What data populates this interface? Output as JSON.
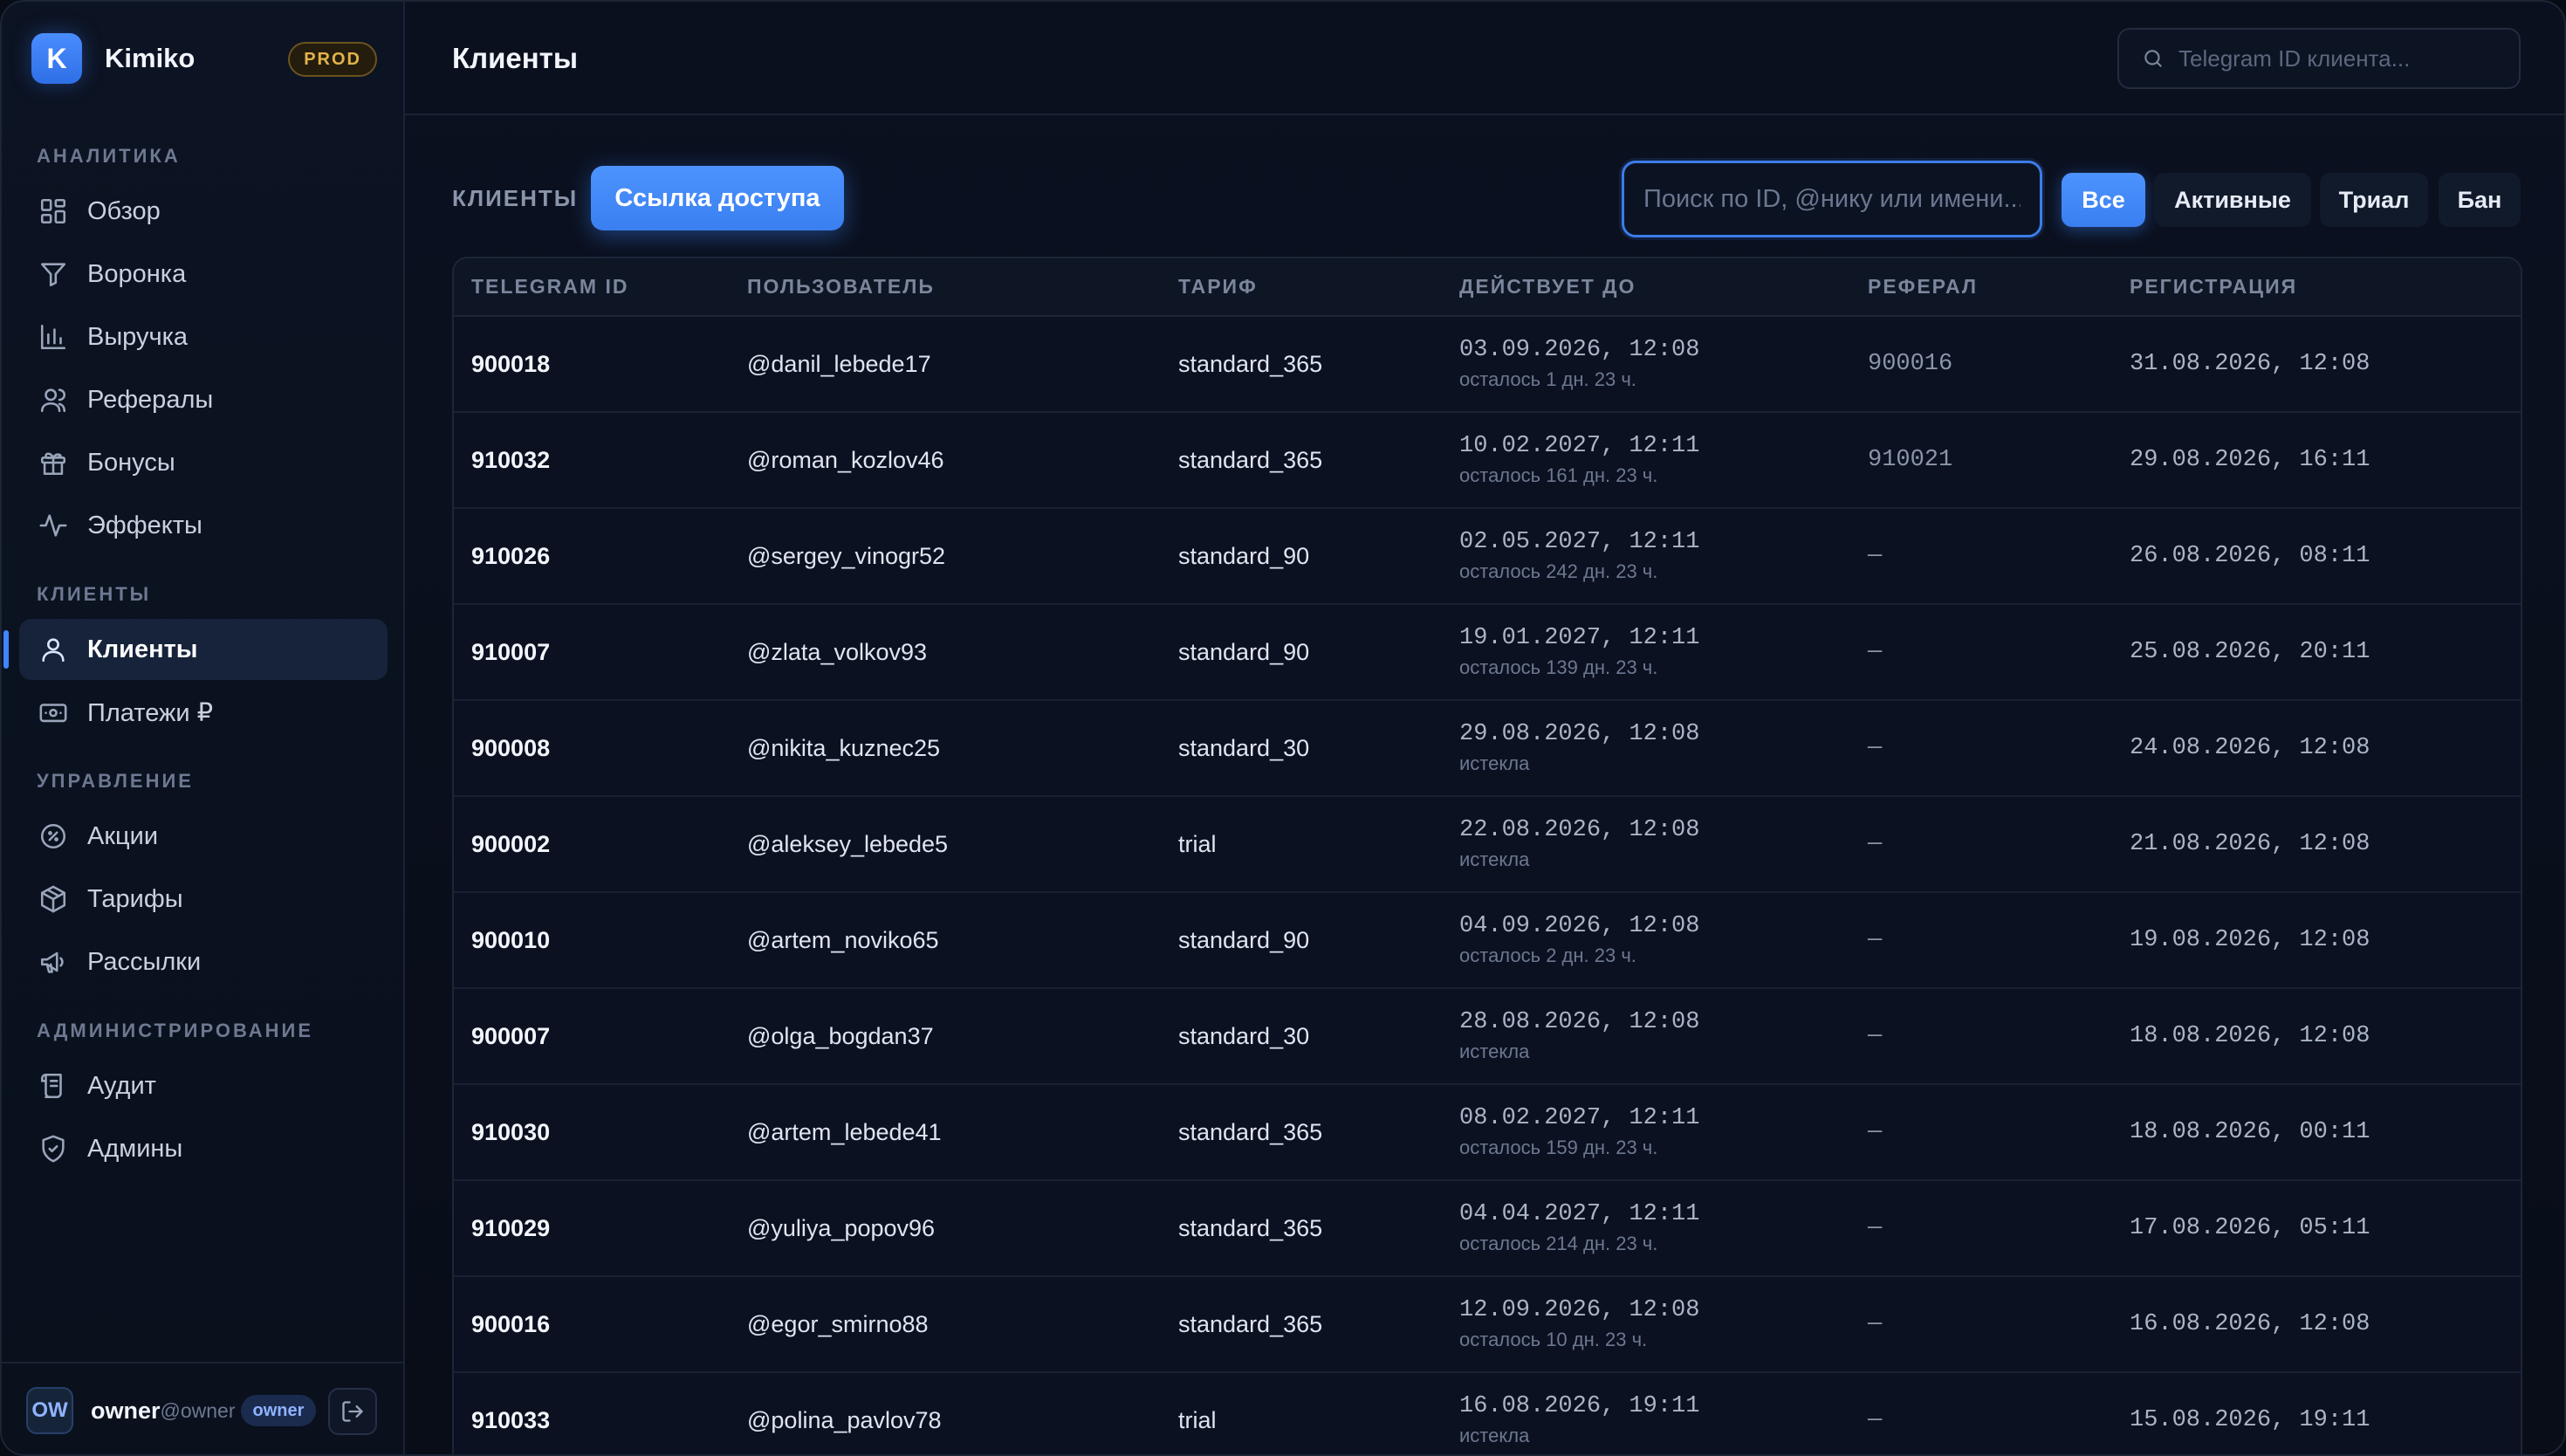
{
  "app": {
    "logo_letter": "K",
    "name": "Kimiko",
    "env_badge": "PROD"
  },
  "sidebar": {
    "sections": [
      {
        "title": "АНАЛИТИКА"
      },
      {
        "title": "КЛИЕНТЫ"
      },
      {
        "title": "УПРАВЛЕНИЕ"
      },
      {
        "title": "АДМИНИСТРИРОВАНИЕ"
      }
    ],
    "items": [
      {
        "label": "Обзор",
        "icon": "dashboard-icon"
      },
      {
        "label": "Воронка",
        "icon": "funnel-icon"
      },
      {
        "label": "Выручка",
        "icon": "bar-chart-icon"
      },
      {
        "label": "Рефералы",
        "icon": "users-icon"
      },
      {
        "label": "Бонусы",
        "icon": "gift-icon"
      },
      {
        "label": "Эффекты",
        "icon": "activity-icon"
      },
      {
        "label": "Клиенты",
        "icon": "user-icon",
        "active": true
      },
      {
        "label": "Платежи ₽",
        "icon": "payment-card-icon"
      },
      {
        "label": "Акции",
        "icon": "promo-badge-icon"
      },
      {
        "label": "Тарифы",
        "icon": "package-icon"
      },
      {
        "label": "Рассылки",
        "icon": "megaphone-icon"
      },
      {
        "label": "Аудит",
        "icon": "scroll-icon"
      },
      {
        "label": "Админы",
        "icon": "shield-icon"
      }
    ]
  },
  "user": {
    "initials": "OW",
    "name": "owner",
    "handle": "@owner",
    "role": "owner",
    "logout_icon": "logout-icon"
  },
  "header": {
    "title": "Клиенты",
    "search_placeholder": "Telegram ID клиента...",
    "search_icon": "search-icon"
  },
  "toolbar": {
    "section_label": "КЛИЕНТЫ",
    "access_link_button": "Ссылка доступа",
    "search_placeholder": "Поиск по ID, @нику или имени...",
    "filters": {
      "all": "Все",
      "active": "Активные",
      "trial": "Триал",
      "ban": "Бан"
    },
    "selected_filter": "Все"
  },
  "table": {
    "columns": [
      "TELEGRAM ID",
      "ПОЛЬЗОВАТЕЛЬ",
      "ТАРИФ",
      "ДЕЙСТВУЕТ ДО",
      "РЕФЕРАЛ",
      "РЕГИСТРАЦИЯ"
    ],
    "rows": [
      {
        "id": "900018",
        "user": "@danil_lebede17",
        "plan": "standard_365",
        "until": "03.09.2026, 12:08",
        "note": "осталось 1 дн. 23 ч.",
        "referral": "900016",
        "registered": "31.08.2026, 12:08"
      },
      {
        "id": "910032",
        "user": "@roman_kozlov46",
        "plan": "standard_365",
        "until": "10.02.2027, 12:11",
        "note": "осталось 161 дн. 23 ч.",
        "referral": "910021",
        "registered": "29.08.2026, 16:11"
      },
      {
        "id": "910026",
        "user": "@sergey_vinogr52",
        "plan": "standard_90",
        "until": "02.05.2027, 12:11",
        "note": "осталось 242 дн. 23 ч.",
        "referral": "—",
        "registered": "26.08.2026, 08:11"
      },
      {
        "id": "910007",
        "user": "@zlata_volkov93",
        "plan": "standard_90",
        "until": "19.01.2027, 12:11",
        "note": "осталось 139 дн. 23 ч.",
        "referral": "—",
        "registered": "25.08.2026, 20:11"
      },
      {
        "id": "900008",
        "user": "@nikita_kuznec25",
        "plan": "standard_30",
        "until": "29.08.2026, 12:08",
        "note": "истекла",
        "referral": "—",
        "registered": "24.08.2026, 12:08"
      },
      {
        "id": "900002",
        "user": "@aleksey_lebede5",
        "plan": "trial",
        "until": "22.08.2026, 12:08",
        "note": "истекла",
        "referral": "—",
        "registered": "21.08.2026, 12:08"
      },
      {
        "id": "900010",
        "user": "@artem_noviko65",
        "plan": "standard_90",
        "until": "04.09.2026, 12:08",
        "note": "осталось 2 дн. 23 ч.",
        "referral": "—",
        "registered": "19.08.2026, 12:08"
      },
      {
        "id": "900007",
        "user": "@olga_bogdan37",
        "plan": "standard_30",
        "until": "28.08.2026, 12:08",
        "note": "истекла",
        "referral": "—",
        "registered": "18.08.2026, 12:08"
      },
      {
        "id": "910030",
        "user": "@artem_lebede41",
        "plan": "standard_365",
        "until": "08.02.2027, 12:11",
        "note": "осталось 159 дн. 23 ч.",
        "referral": "—",
        "registered": "18.08.2026, 00:11"
      },
      {
        "id": "910029",
        "user": "@yuliya_popov96",
        "plan": "standard_365",
        "until": "04.04.2027, 12:11",
        "note": "осталось 214 дн. 23 ч.",
        "referral": "—",
        "registered": "17.08.2026, 05:11"
      },
      {
        "id": "900016",
        "user": "@egor_smirno88",
        "plan": "standard_365",
        "until": "12.09.2026, 12:08",
        "note": "осталось 10 дн. 23 ч.",
        "referral": "—",
        "registered": "16.08.2026, 12:08"
      },
      {
        "id": "910033",
        "user": "@polina_pavlov78",
        "plan": "trial",
        "until": "16.08.2026, 19:11",
        "note": "истекла",
        "referral": "—",
        "registered": "15.08.2026, 19:11"
      }
    ]
  },
  "colors": {
    "accent": "#3d86ff",
    "background": "#070b14",
    "prod_badge": "#e4b24a"
  }
}
